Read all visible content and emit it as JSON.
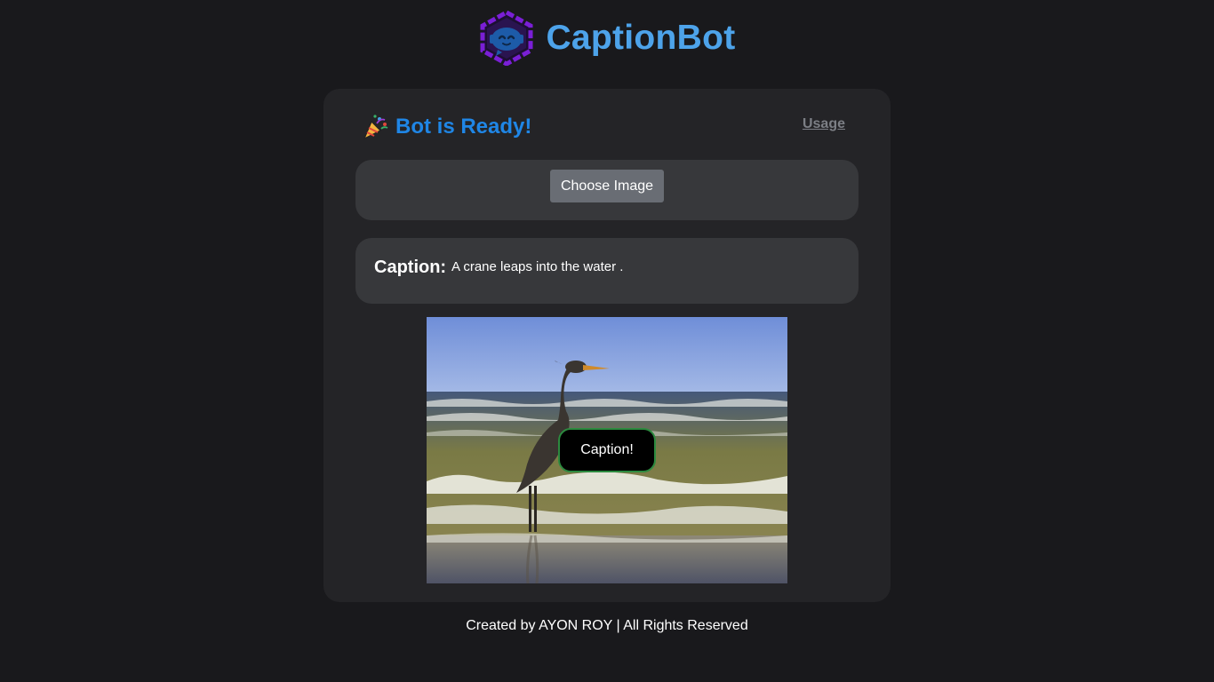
{
  "header": {
    "app_title": "CaptionBot",
    "logo_icon": "bot-logo-icon"
  },
  "card": {
    "status_icon": "party-popper-icon",
    "status_text": "Bot is Ready!",
    "usage_link": "Usage",
    "choose_button": "Choose Image",
    "caption_label": "Caption:",
    "caption_text": "A crane leaps into the water .",
    "caption_button": "Caption!"
  },
  "footer": {
    "text": "Created by AYON ROY | All Rights Reserved"
  },
  "colors": {
    "background": "#19191c",
    "card": "#242427",
    "panel": "#37383b",
    "accent_title": "#4da3ea",
    "accent_status": "#1f86e6",
    "button": "#696d74",
    "caption_button_border": "#2c8a3f"
  }
}
